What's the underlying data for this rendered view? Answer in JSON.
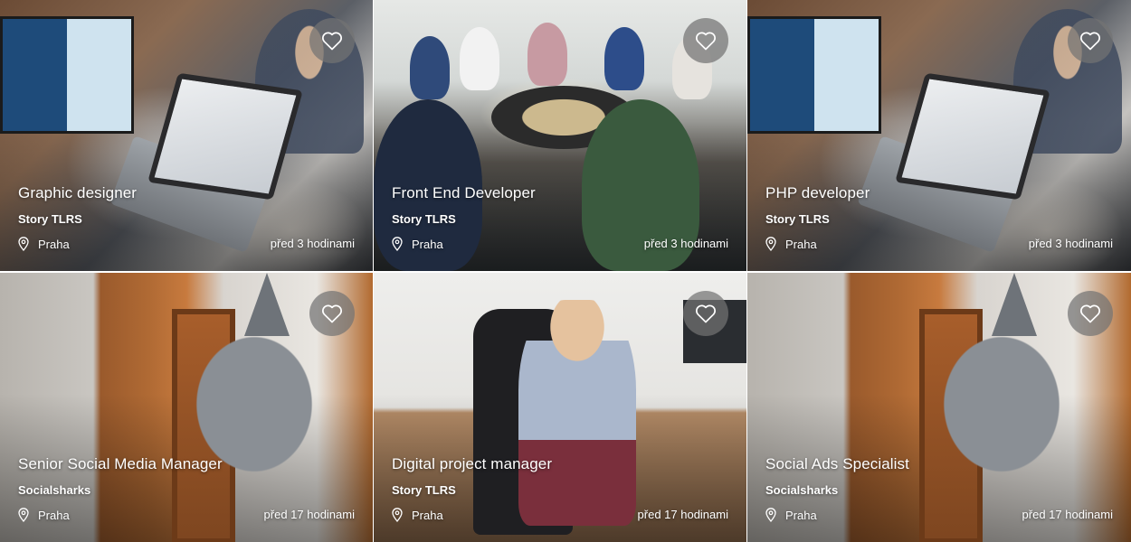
{
  "cards": [
    {
      "title": "Graphic designer",
      "company": "Story TLRS",
      "location": "Praha",
      "time": "před 3 hodinami",
      "photo": "office-laptop",
      "icons": {
        "favorite": "heart-outline-icon",
        "location": "map-pin-icon"
      }
    },
    {
      "title": "Front End Developer",
      "company": "Story TLRS",
      "location": "Praha",
      "time": "před 3 hodinami",
      "photo": "team-meeting",
      "icons": {
        "favorite": "heart-outline-icon",
        "location": "map-pin-icon"
      }
    },
    {
      "title": "PHP developer",
      "company": "Story TLRS",
      "location": "Praha",
      "time": "před 3 hodinami",
      "photo": "office-laptop",
      "icons": {
        "favorite": "heart-outline-icon",
        "location": "map-pin-icon"
      }
    },
    {
      "title": "Senior Social Media Manager",
      "company": "Socialsharks",
      "location": "Praha",
      "time": "před 17 hodinami",
      "photo": "shark-wall",
      "icons": {
        "favorite": "heart-outline-icon",
        "location": "map-pin-icon"
      }
    },
    {
      "title": "Digital project manager",
      "company": "Story TLRS",
      "location": "Praha",
      "time": "před 17 hodinami",
      "photo": "desk-chair",
      "icons": {
        "favorite": "heart-outline-icon",
        "location": "map-pin-icon"
      }
    },
    {
      "title": "Social Ads Specialist",
      "company": "Socialsharks",
      "location": "Praha",
      "time": "před 17 hodinami",
      "photo": "shark-wall",
      "icons": {
        "favorite": "heart-outline-icon",
        "location": "map-pin-icon"
      }
    }
  ],
  "colors": {
    "text": "#ffffff",
    "heart_button_bg": "#737373"
  }
}
